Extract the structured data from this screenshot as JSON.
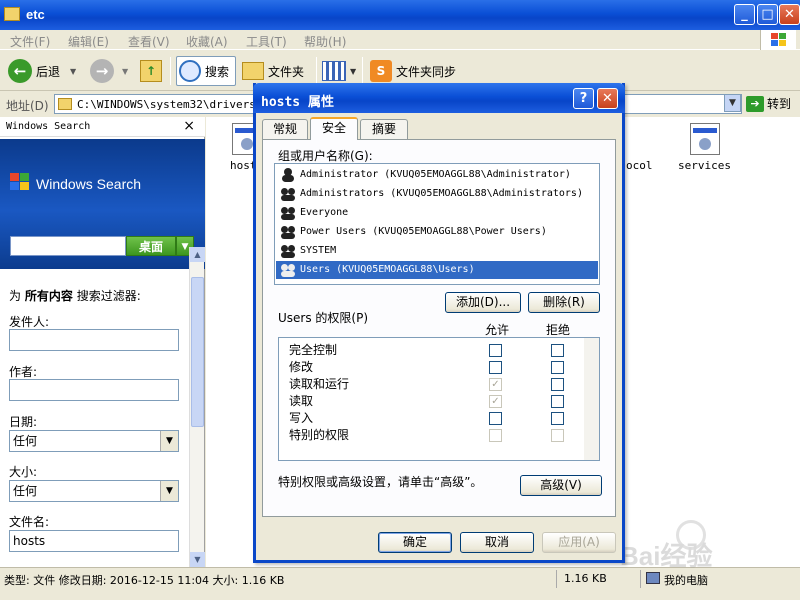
{
  "window": {
    "title": "etc"
  },
  "menu": [
    "文件(F)",
    "编辑(E)",
    "查看(V)",
    "收藏(A)",
    "工具(T)",
    "帮助(H)"
  ],
  "toolbar": {
    "back": "后退",
    "search": "搜索",
    "folders": "文件夹",
    "sync": "文件夹同步"
  },
  "address": {
    "label": "地址(D)",
    "path": "C:\\WINDOWS\\system32\\drivers\\etc",
    "go": "转到"
  },
  "search_pane": {
    "header": "Windows Search",
    "brand": "Windows Search",
    "scope_button": "桌面",
    "filter_prefix": "为",
    "filter_bold": "所有内容",
    "filter_suffix": "搜索过滤器:",
    "sender_label": "发件人:",
    "author_label": "作者:",
    "date_label": "日期:",
    "date_value": "任何",
    "size_label": "大小:",
    "size_value": "任何",
    "filename_label": "文件名:",
    "filename_value": "hosts"
  },
  "files": [
    {
      "name": "hosts"
    },
    {
      "name": "ocol"
    },
    {
      "name": "services"
    }
  ],
  "status": {
    "info": "类型: 文件 修改日期: 2016-12-15 11:04 大小: 1.16 KB",
    "size": "1.16 KB",
    "zone": "我的电脑"
  },
  "watermark": "Bai经验",
  "dialog": {
    "title": "hosts 属性",
    "tabs": [
      "常规",
      "安全",
      "摘要"
    ],
    "active_tab": "安全",
    "group_label": "组或用户名称(G):",
    "users": [
      "Administrator (KVUQ05EMOAGGL88\\Administrator)",
      "Administrators (KVUQ05EMOAGGL88\\Administrators)",
      "Everyone",
      "Power Users (KVUQ05EMOAGGL88\\Power Users)",
      "SYSTEM",
      "Users (KVUQ05EMOAGGL88\\Users)"
    ],
    "selected_user": "Users (KVUQ05EMOAGGL88\\Users)",
    "add_button": "添加(D)...",
    "remove_button": "删除(R)",
    "perm_label": "Users 的权限(P)",
    "allow_header": "允许",
    "deny_header": "拒绝",
    "permissions": [
      {
        "name": "完全控制",
        "allow": false,
        "allow_disabled": false,
        "deny": false
      },
      {
        "name": "修改",
        "allow": false,
        "allow_disabled": false,
        "deny": false
      },
      {
        "name": "读取和运行",
        "allow": true,
        "allow_disabled": true,
        "deny": false
      },
      {
        "name": "读取",
        "allow": true,
        "allow_disabled": true,
        "deny": false
      },
      {
        "name": "写入",
        "allow": false,
        "allow_disabled": false,
        "deny": false
      },
      {
        "name": "特别的权限",
        "allow": false,
        "allow_disabled": true,
        "deny": false
      }
    ],
    "advanced_hint": "特别权限或高级设置，请单击“高级”。",
    "advanced_button": "高级(V)",
    "ok_button": "确定",
    "cancel_button": "取消",
    "apply_button": "应用(A)"
  },
  "colors": {
    "titlebar": "#0a4fd6",
    "selection": "#316ac5",
    "ws_banner": "#1a58c2",
    "ws_button": "#4ca42a"
  }
}
